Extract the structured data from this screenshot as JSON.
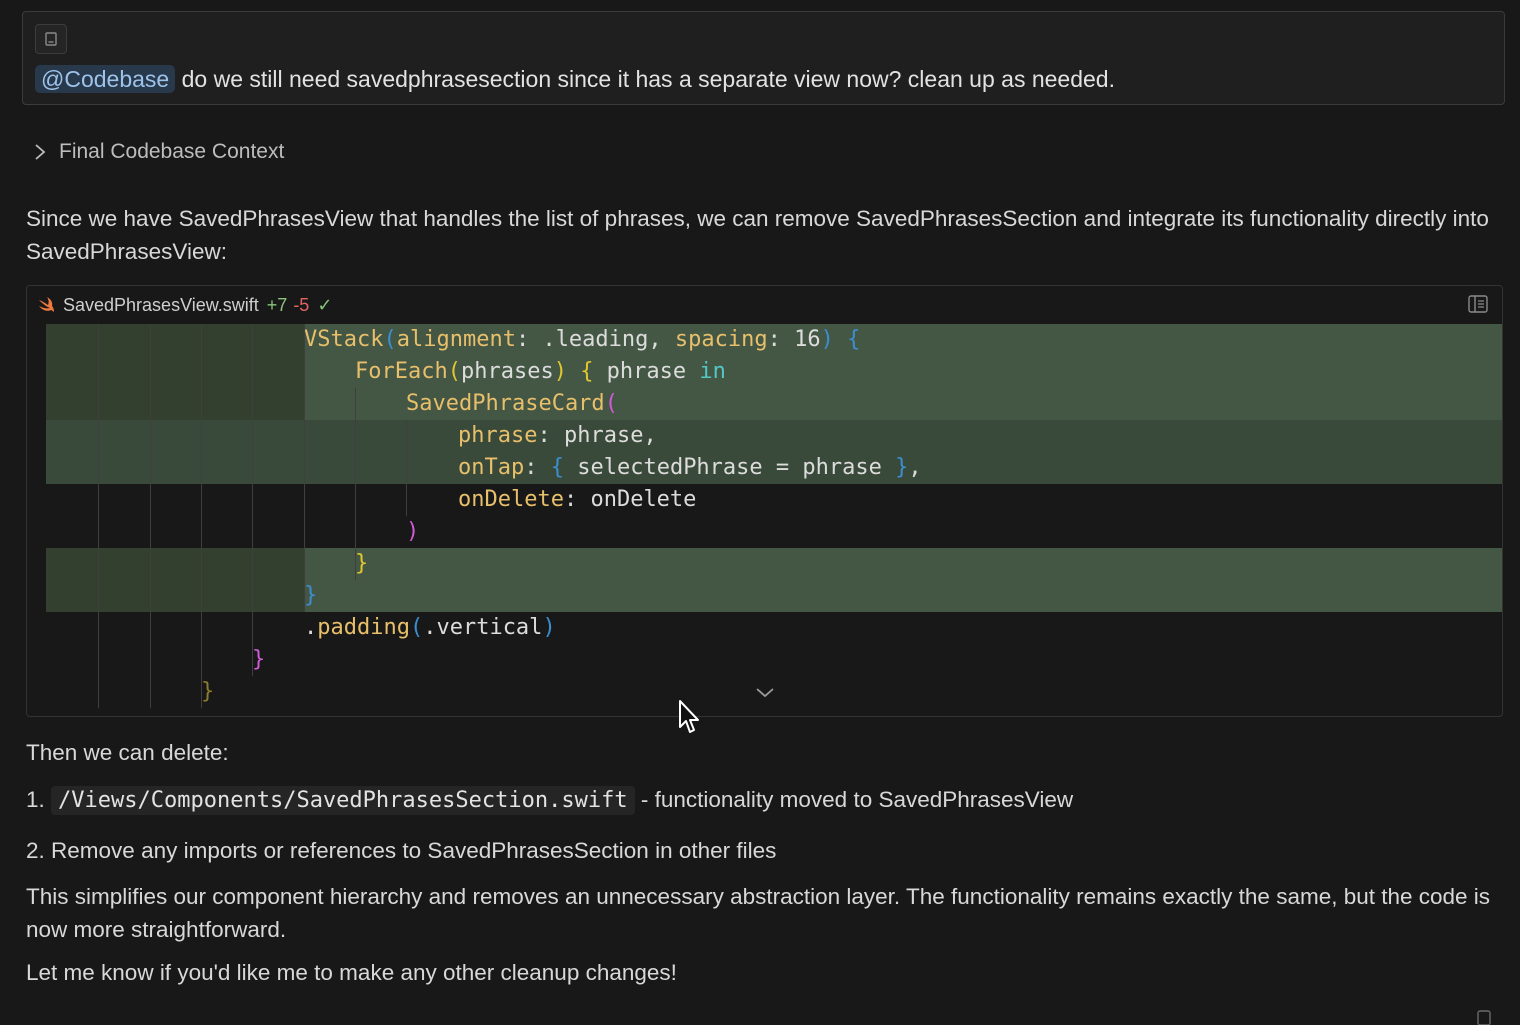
{
  "prompt": {
    "mention": "@Codebase",
    "text": "do we still need savedphrasesection since it has a separate view now? clean up as needed."
  },
  "context_toggle": {
    "label": "Final Codebase Context"
  },
  "intro": "Since we have SavedPhrasesView that handles the list of phrases, we can remove SavedPhrasesSection and integrate its functionality directly into SavedPhrasesView:",
  "code_block": {
    "filename": "SavedPhrasesView.swift",
    "additions": "+7",
    "deletions": "-5",
    "status_icon": "check-icon",
    "lines": [
      [
        {
          "t": "VStack",
          "c": "fn"
        },
        {
          "t": "(",
          "c": "p1"
        },
        {
          "t": "alignment",
          "c": "lbl"
        },
        {
          "t": ": .leading, ",
          "c": "op"
        },
        {
          "t": "spacing",
          "c": "lbl"
        },
        {
          "t": ": 16",
          "c": "op"
        },
        {
          "t": ")",
          "c": "p1"
        },
        {
          "t": " ",
          "c": "op"
        },
        {
          "t": "{",
          "c": "p1"
        }
      ],
      [
        {
          "t": "ForEach",
          "c": "fn"
        },
        {
          "t": "(",
          "c": "p2"
        },
        {
          "t": "phrases",
          "c": "id"
        },
        {
          "t": ")",
          "c": "p2"
        },
        {
          "t": " ",
          "c": "op"
        },
        {
          "t": "{",
          "c": "p2"
        },
        {
          "t": " phrase ",
          "c": "id"
        },
        {
          "t": "in",
          "c": "kw"
        }
      ],
      [
        {
          "t": "SavedPhraseCard",
          "c": "fn"
        },
        {
          "t": "(",
          "c": "p3"
        }
      ],
      [
        {
          "t": "phrase",
          "c": "lbl"
        },
        {
          "t": ": phrase,",
          "c": "op"
        }
      ],
      [
        {
          "t": "onTap",
          "c": "lbl"
        },
        {
          "t": ": ",
          "c": "op"
        },
        {
          "t": "{",
          "c": "p1"
        },
        {
          "t": " selectedPhrase = phrase ",
          "c": "id"
        },
        {
          "t": "}",
          "c": "p1"
        },
        {
          "t": ",",
          "c": "op"
        }
      ],
      [
        {
          "t": "onDelete",
          "c": "lbl"
        },
        {
          "t": ": onDelete",
          "c": "op"
        }
      ],
      [
        {
          "t": ")",
          "c": "p3"
        }
      ],
      [
        {
          "t": "}",
          "c": "p2"
        }
      ],
      [
        {
          "t": "}",
          "c": "p1"
        }
      ],
      [
        {
          "t": ".",
          "c": "op"
        },
        {
          "t": "padding",
          "c": "fn"
        },
        {
          "t": "(",
          "c": "p1"
        },
        {
          "t": ".vertical",
          "c": "id"
        },
        {
          "t": ")",
          "c": "p1"
        }
      ],
      [
        {
          "t": "}",
          "c": "p3"
        }
      ],
      [
        {
          "t": "}",
          "c": "p4"
        }
      ]
    ]
  },
  "then_text": "Then we can delete:",
  "list": [
    {
      "num": "1.",
      "code": "/Views/Components/SavedPhrasesSection.swift",
      "text": "- functionality moved to SavedPhrasesView"
    },
    {
      "num": "2.",
      "text": "Remove any imports or references to SavedPhrasesSection in other files"
    }
  ],
  "summary": "This simplifies our component hierarchy and removes an unnecessary abstraction layer. The functionality remains exactly the same, but the code is now more straightforward.",
  "closing": "Let me know if you'd like me to make any other cleanup changes!",
  "colors": {
    "background": "#181818",
    "added_line": "#445745",
    "mention_bg": "#28394c",
    "additions": "#89c37a",
    "deletions": "#e0645f"
  }
}
